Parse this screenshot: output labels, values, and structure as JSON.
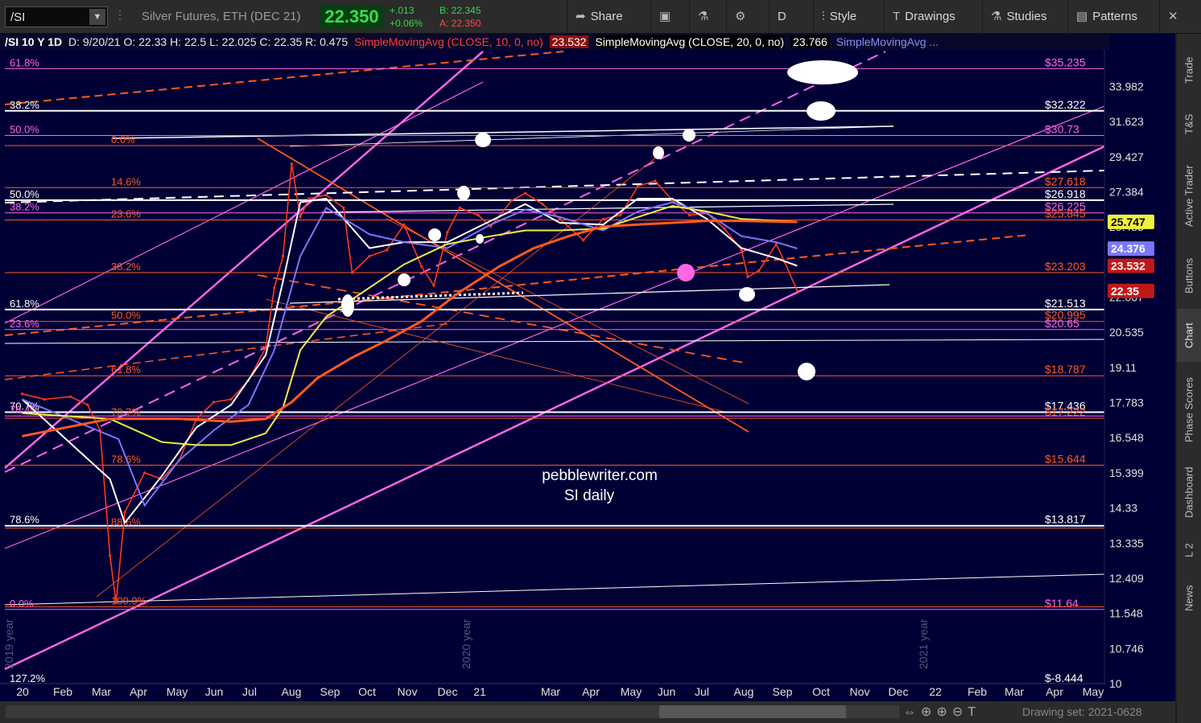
{
  "toolbar": {
    "symbol": "/SI",
    "description": "Silver Futures, ETH (DEC 21)",
    "last_price": "22.350",
    "net_change": "+.013",
    "pct_change": "+0.06%",
    "bid": "B: 22.345",
    "ask": "A: 22.350",
    "buttons": {
      "share": "Share",
      "period": "D",
      "style": "Style",
      "drawings": "Drawings",
      "studies": "Studies",
      "patterns": "Patterns"
    }
  },
  "legend": {
    "header": "/SI 10 Y 1D",
    "ohlc": "D: 9/20/21  O: 22.33  H: 22.5  L: 22.025  C: 22.35  R: 0.475",
    "sma10_label": "SimpleMovingAvg (CLOSE, 10, 0, no)",
    "sma10_value": "23.532",
    "sma20_label": "SimpleMovingAvg (CLOSE, 20, 0, no)",
    "sma20_value": "23.766",
    "sma3_label": "SimpleMovingAvg ..."
  },
  "colors": {
    "background": "#000035",
    "fib_orange": "#ff5a1e",
    "fib_pink": "#ff66e6",
    "fib_white": "#ffffff",
    "candle": "#ff3a1a",
    "sma_yellow": "#f0f03c",
    "sma_blue": "#7878ff"
  },
  "chart_data": {
    "type": "line",
    "title": "/SI 10 Y 1D",
    "watermark": [
      "pebblewriter.com",
      "SI daily"
    ],
    "x_tick_labels": [
      "20",
      "Feb",
      "Mar",
      "Apr",
      "May",
      "Jun",
      "Jul",
      "Aug",
      "Sep",
      "Oct",
      "Nov",
      "Dec",
      "21",
      "Mar",
      "Apr",
      "May",
      "Jun",
      "Jul",
      "Aug",
      "Sep",
      "Oct",
      "Nov",
      "Dec",
      "22",
      "Feb",
      "Mar",
      "Apr",
      "May"
    ],
    "year_markers": [
      "2019 year",
      "2020 year",
      "2021 year"
    ],
    "y_tick_labels": [
      "33.982",
      "31.623",
      "29.427",
      "27.384",
      "25.483",
      "22.067",
      "20.535",
      "19.11",
      "17.783",
      "16.548",
      "15.399",
      "14.33",
      "13.335",
      "12.409",
      "11.548",
      "10.746",
      "10"
    ],
    "y_scale": "log",
    "ylim": [
      10,
      36.5
    ],
    "price_badges": [
      {
        "label": "25.747",
        "value": 25.747,
        "color": "#f0f03c"
      },
      {
        "label": "24.376",
        "value": 24.376,
        "color": "#7878ff"
      },
      {
        "label": "23.532",
        "value": 23.532,
        "color": "#c01818"
      },
      {
        "label": "22.35",
        "value": 22.35,
        "color": "#c01818"
      }
    ],
    "horizontal_levels": [
      {
        "left_text": "61.8%",
        "right_text": "$35.235",
        "value": 35.235,
        "color": "#ff66e6"
      },
      {
        "left_text": "38.2%",
        "right_text": "$32.322",
        "value": 32.322,
        "color": "#ffffff"
      },
      {
        "left_text": "50.0%",
        "right_text": "$30.73",
        "value": 30.73,
        "color": "#ff66e6"
      },
      {
        "left_text": "0.0%",
        "right_text": "",
        "value": 30.1,
        "color": "#ff5a1e"
      },
      {
        "left_text": "14.6%",
        "right_text": "$27.618",
        "value": 27.618,
        "color": "#ff5a1e"
      },
      {
        "left_text": "50.0%",
        "right_text": "$26.918",
        "value": 26.918,
        "color": "#ffffff"
      },
      {
        "left_text": "38.2%",
        "right_text": "$26.225",
        "value": 26.225,
        "color": "#ff66e6"
      },
      {
        "left_text": "23.6%",
        "right_text": "$25.845",
        "value": 25.845,
        "color": "#ff5a1e"
      },
      {
        "left_text": "38.2%",
        "right_text": "$23.203",
        "value": 23.203,
        "color": "#ff5a1e"
      },
      {
        "left_text": "61.8%",
        "right_text": "$21.513",
        "value": 21.513,
        "color": "#ffffff"
      },
      {
        "left_text": "50.0%",
        "right_text": "$20.995",
        "value": 20.995,
        "color": "#ff5a1e"
      },
      {
        "left_text": "23.6%",
        "right_text": "$20.65",
        "value": 20.65,
        "color": "#ff66e6"
      },
      {
        "left_text": "61.8%",
        "right_text": "$18.787",
        "value": 18.787,
        "color": "#ff5a1e"
      },
      {
        "left_text": "70.7%",
        "right_text": "$17.436",
        "value": 17.436,
        "color": "#ffffff"
      },
      {
        "left_text": "70.7%",
        "right_text": "$17.222",
        "value": 17.222,
        "color": "#ff5a1e"
      },
      {
        "left_text": "76.4%",
        "right_text": "",
        "value": 17.3,
        "color": "#ff66e6"
      },
      {
        "left_text": "78.6%",
        "right_text": "$15.644",
        "value": 15.644,
        "color": "#ff5a1e"
      },
      {
        "left_text": "78.6%",
        "right_text": "$13.817",
        "value": 13.817,
        "color": "#ffffff"
      },
      {
        "left_text": "88.6%",
        "right_text": "",
        "value": 13.75,
        "color": "#ff5a1e"
      },
      {
        "left_text": "0.0%",
        "right_text": "$11.64",
        "value": 11.64,
        "color": "#ff66e6"
      },
      {
        "left_text": "100.0%",
        "right_text": "",
        "value": 11.7,
        "color": "#ff5a1e"
      },
      {
        "left_text": "127.2%",
        "right_text": "$-8.444",
        "value": 9.98,
        "color": "#ffffff"
      }
    ],
    "series": [
      {
        "name": "/SI",
        "color": "#ff3a1a",
        "x": [
          "2020-01-02",
          "2020-01-20",
          "2020-02-10",
          "2020-02-24",
          "2020-03-05",
          "2020-03-13",
          "2020-03-18",
          "2020-03-25",
          "2020-04-10",
          "2020-04-24",
          "2020-05-08",
          "2020-05-22",
          "2020-06-05",
          "2020-06-19",
          "2020-07-03",
          "2020-07-17",
          "2020-07-24",
          "2020-07-31",
          "2020-08-07",
          "2020-08-14",
          "2020-08-21",
          "2020-09-04",
          "2020-09-18",
          "2020-09-25",
          "2020-10-09",
          "2020-10-23",
          "2020-11-06",
          "2020-11-20",
          "2020-11-30",
          "2020-12-11",
          "2020-12-21",
          "2021-01-05",
          "2021-01-15",
          "2021-02-01",
          "2021-02-12",
          "2021-02-26",
          "2021-03-12",
          "2021-03-31",
          "2021-04-16",
          "2021-04-30",
          "2021-05-14",
          "2021-05-28",
          "2021-06-11",
          "2021-06-25",
          "2021-07-09",
          "2021-07-23",
          "2021-08-06",
          "2021-08-11",
          "2021-08-20",
          "2021-09-03",
          "2021-09-10",
          "2021-09-20"
        ],
        "values": [
          18.1,
          17.9,
          18.0,
          17.7,
          16.8,
          13.0,
          11.8,
          14.2,
          15.4,
          15.2,
          15.8,
          17.2,
          17.8,
          17.9,
          18.6,
          19.9,
          22.5,
          24.0,
          29.0,
          26.0,
          27.0,
          27.2,
          26.5,
          23.2,
          24.0,
          24.3,
          25.6,
          23.5,
          22.6,
          25.2,
          26.5,
          26.1,
          25.5,
          26.9,
          27.3,
          26.7,
          25.9,
          24.8,
          25.9,
          26.1,
          27.7,
          28.0,
          26.9,
          26.1,
          26.2,
          25.4,
          24.3,
          23.0,
          23.3,
          24.6,
          23.7,
          22.35
        ]
      },
      {
        "name": "SimpleMovingAvg (CLOSE, 10, 0, no)",
        "color": "#ffffff",
        "x": [
          "2020-01-02",
          "2020-03-13",
          "2020-03-25",
          "2020-04-24",
          "2020-05-22",
          "2020-06-19",
          "2020-07-17",
          "2020-07-31",
          "2020-08-14",
          "2020-09-04",
          "2020-10-09",
          "2020-11-06",
          "2020-12-11",
          "2021-01-15",
          "2021-02-12",
          "2021-03-12",
          "2021-04-16",
          "2021-05-14",
          "2021-06-11",
          "2021-07-09",
          "2021-08-06",
          "2021-09-03",
          "2021-09-20"
        ],
        "values": [
          17.9,
          15.2,
          13.9,
          15.3,
          16.9,
          17.7,
          19.6,
          22.8,
          26.8,
          27.0,
          24.4,
          24.7,
          24.7,
          25.8,
          26.7,
          25.7,
          25.6,
          27.0,
          27.0,
          25.9,
          24.4,
          23.9,
          23.53
        ]
      },
      {
        "name": "SimpleMovingAvg (CLOSE, 20, 0, no)",
        "color": "#7878ff",
        "x": [
          "2020-01-02",
          "2020-03-20",
          "2020-04-10",
          "2020-05-08",
          "2020-06-05",
          "2020-07-03",
          "2020-07-24",
          "2020-08-14",
          "2020-09-04",
          "2020-10-09",
          "2020-11-06",
          "2020-12-11",
          "2021-01-15",
          "2021-02-12",
          "2021-03-12",
          "2021-04-16",
          "2021-05-14",
          "2021-06-11",
          "2021-07-09",
          "2021-08-06",
          "2021-09-03",
          "2021-09-20"
        ],
        "values": [
          17.9,
          16.5,
          14.4,
          15.8,
          16.8,
          17.7,
          19.8,
          24.0,
          26.5,
          25.1,
          24.7,
          24.4,
          25.6,
          26.4,
          26.0,
          25.3,
          26.3,
          26.8,
          26.2,
          25.0,
          24.7,
          24.38
        ]
      },
      {
        "name": "SimpleMovingAvg yellow",
        "color": "#f0f03c",
        "x": [
          "2020-01-02",
          "2020-03-13",
          "2020-04-24",
          "2020-05-22",
          "2020-06-19",
          "2020-07-17",
          "2020-07-31",
          "2020-08-14",
          "2020-09-04",
          "2020-10-09",
          "2020-11-06",
          "2020-12-11",
          "2021-01-15",
          "2021-02-12",
          "2021-03-12",
          "2021-04-16",
          "2021-05-14",
          "2021-06-11",
          "2021-07-09",
          "2021-08-06",
          "2021-09-20"
        ],
        "values": [
          17.4,
          17.2,
          16.4,
          16.3,
          16.3,
          16.7,
          17.6,
          19.8,
          21.2,
          22.5,
          23.6,
          24.6,
          25.0,
          25.3,
          25.3,
          25.4,
          26.0,
          26.6,
          26.3,
          25.9,
          25.75
        ]
      },
      {
        "name": "SimpleMovingAvg orange",
        "color": "#ff5a1e",
        "x": [
          "2020-01-02",
          "2020-03-13",
          "2020-05-08",
          "2020-06-19",
          "2020-07-17",
          "2020-08-07",
          "2020-08-28",
          "2020-09-25",
          "2020-10-23",
          "2020-11-20",
          "2020-12-21",
          "2021-01-22",
          "2021-02-19",
          "2021-03-19",
          "2021-04-16",
          "2021-05-14",
          "2021-06-11",
          "2021-07-09",
          "2021-08-06",
          "2021-09-20"
        ],
        "values": [
          16.6,
          17.2,
          17.2,
          17.1,
          17.2,
          17.8,
          18.7,
          19.5,
          20.2,
          21.0,
          22.3,
          23.5,
          24.4,
          25.0,
          25.5,
          25.6,
          25.7,
          25.8,
          25.8,
          25.74
        ]
      }
    ]
  },
  "bottombar": {
    "drawing_set": "Drawing set: 2021-0628"
  },
  "sidebar": {
    "tabs": [
      "Trade",
      "T&S",
      "Active Trader",
      "Buttons",
      "Chart",
      "Phase Scores",
      "Dashboard",
      "L 2",
      "News"
    ]
  }
}
